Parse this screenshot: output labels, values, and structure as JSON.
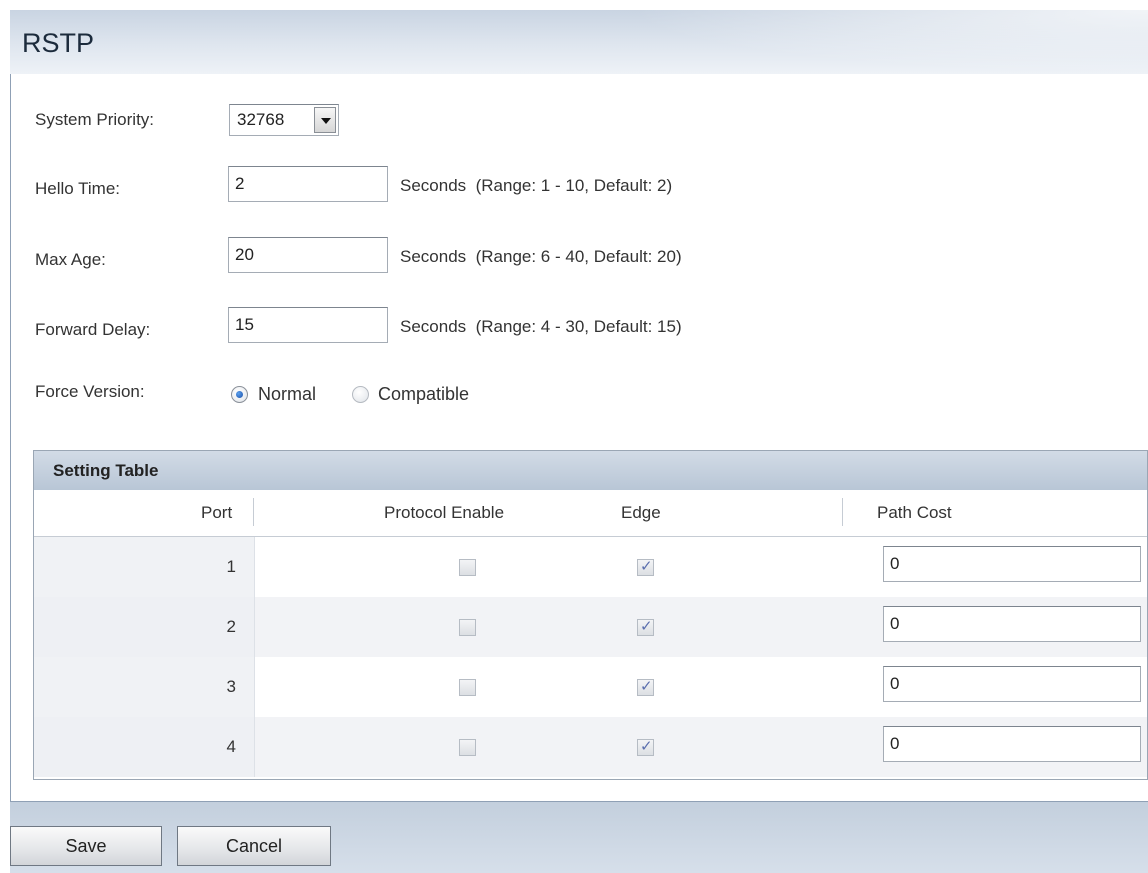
{
  "page": {
    "title": "RSTP"
  },
  "form": {
    "system_priority": {
      "label": "System Priority:",
      "value": "32768"
    },
    "hello_time": {
      "label": "Hello Time:",
      "value": "2",
      "help": "Seconds  (Range: 1 - 10, Default: 2)"
    },
    "max_age": {
      "label": "Max Age:",
      "value": "20",
      "help": "Seconds  (Range: 6 - 40, Default: 20)"
    },
    "forward_delay": {
      "label": "Forward Delay:",
      "value": "15",
      "help": "Seconds  (Range: 4 - 30, Default: 15)"
    },
    "force_version": {
      "label": "Force Version:",
      "options": [
        {
          "label": "Normal",
          "checked": true
        },
        {
          "label": "Compatible",
          "checked": false
        }
      ]
    }
  },
  "setting_table": {
    "title": "Setting Table",
    "columns": [
      "Port",
      "Protocol Enable",
      "Edge",
      "Path Cost"
    ],
    "rows": [
      {
        "port": "1",
        "protocol_enable": false,
        "edge": true,
        "path_cost": "0"
      },
      {
        "port": "2",
        "protocol_enable": false,
        "edge": true,
        "path_cost": "0"
      },
      {
        "port": "3",
        "protocol_enable": false,
        "edge": true,
        "path_cost": "0"
      },
      {
        "port": "4",
        "protocol_enable": false,
        "edge": true,
        "path_cost": "0"
      }
    ]
  },
  "buttons": {
    "save": "Save",
    "cancel": "Cancel"
  }
}
